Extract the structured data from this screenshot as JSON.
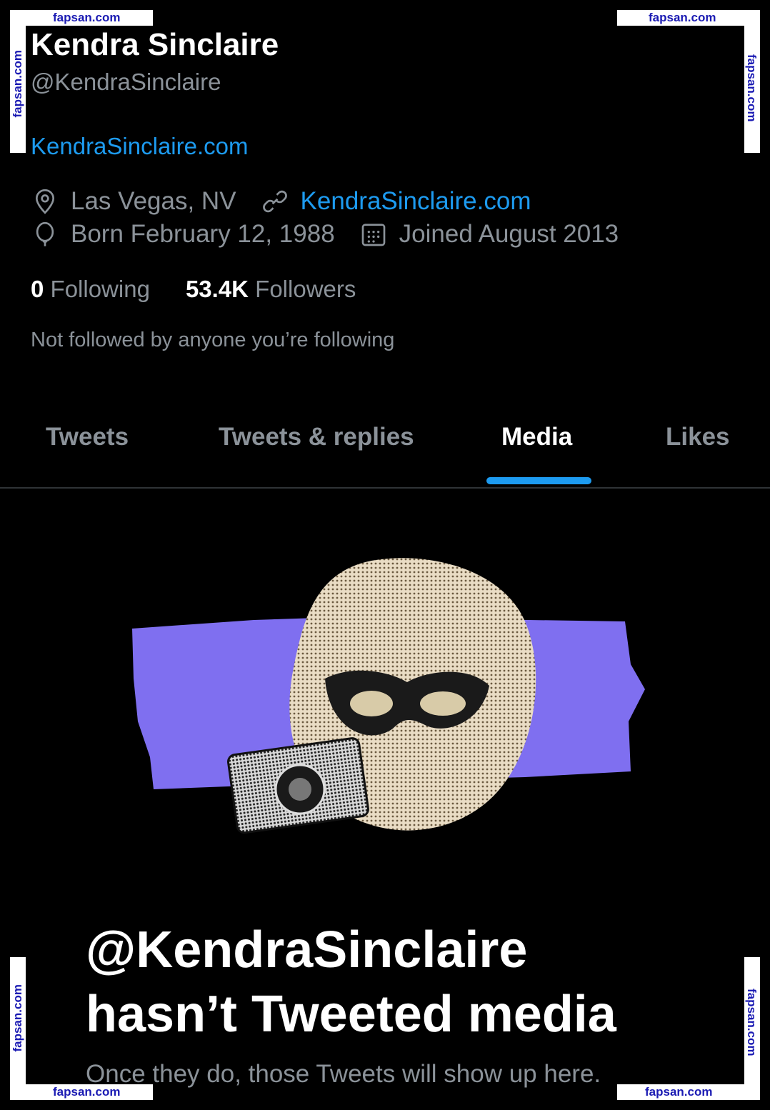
{
  "watermark": {
    "text": "fapsan.com"
  },
  "profile": {
    "name": "Kendra Sinclaire",
    "handle": "@KendraSinclaire",
    "bio_link": "KendraSinclaire.com",
    "location": "Las Vegas, NV",
    "website": "KendraSinclaire.com",
    "birthday": "Born February 12, 1988",
    "joined": "Joined August 2013",
    "following_count": "0",
    "following_label": "Following",
    "followers_count": "53.4K",
    "followers_label": "Followers",
    "not_followed_text": "Not followed by anyone you’re following"
  },
  "tabs": [
    {
      "label": "Tweets",
      "active": false
    },
    {
      "label": "Tweets & replies",
      "active": false
    },
    {
      "label": "Media",
      "active": true
    },
    {
      "label": "Likes",
      "active": false
    }
  ],
  "empty_state": {
    "title_line1": "@KendraSinclaire",
    "title_line2": "hasn’t Tweeted media",
    "subtitle": "Once they do, those Tweets will show up here."
  },
  "colors": {
    "background": "#000000",
    "accent": "#1d9bf0",
    "muted": "#8b9299",
    "illustration_band": "#7f6ff0"
  }
}
